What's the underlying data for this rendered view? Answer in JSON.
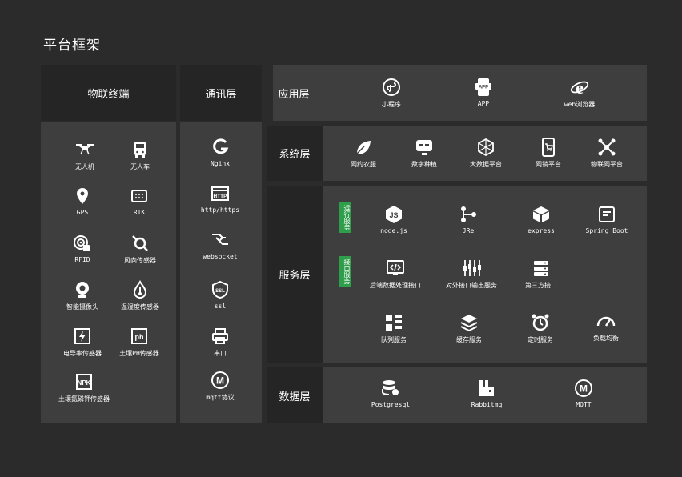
{
  "title": "平台框架",
  "left": {
    "iot_header": "物联终端",
    "comm_header": "通讯层",
    "iot_items": [
      "无人机",
      "无人车",
      "GPS",
      "RTK",
      "RFID",
      "风向传感器",
      "智能摄像头",
      "温湿度传感器",
      "电导率传感器",
      "土壤PH传感器",
      "土壤氮磷钾传感器"
    ],
    "comm_items": [
      "Nginx",
      "http/https",
      "websocket",
      "ssl",
      "串口",
      "mqtt协议"
    ]
  },
  "layers": {
    "app": {
      "label": "应用层",
      "items": [
        "小程序",
        "APP",
        "web浏览器"
      ]
    },
    "system": {
      "label": "系统层",
      "items": [
        "网约农服",
        "数字种植",
        "大数据平台",
        "网销平台",
        "物联网平台"
      ]
    },
    "service": {
      "label": "服务层",
      "runtime_tag": "运行服务",
      "interface_tag": "接口服务",
      "runtime_items": [
        "node.js",
        "JRe",
        "express",
        "Spring Boot"
      ],
      "interface_items": [
        "后端数据处理接口",
        "对外接口输出服务",
        "第三方接口"
      ],
      "other_items": [
        "队列服务",
        "缓存服务",
        "定时服务",
        "负载均衡"
      ]
    },
    "data": {
      "label": "数据层",
      "items": [
        "Postgresql",
        "Rabbitmq",
        "MQTT"
      ]
    }
  },
  "icons": {
    "iot": [
      "drone-icon",
      "vehicle-icon",
      "location-pin-icon",
      "rtk-device-icon",
      "rfid-icon",
      "wind-sensor-icon",
      "camera-icon",
      "humidity-sensor-icon",
      "conductivity-sensor-icon",
      "ph-sensor-icon",
      "npk-sensor-icon"
    ],
    "comm": [
      "nginx-icon",
      "http-icon",
      "websocket-icon",
      "ssl-shield-icon",
      "printer-port-icon",
      "mqtt-icon"
    ]
  },
  "colors": {
    "background": "#2b2b2b",
    "panel": "#3e3e3e",
    "header": "#252525",
    "tag": "#2f9e4a"
  }
}
